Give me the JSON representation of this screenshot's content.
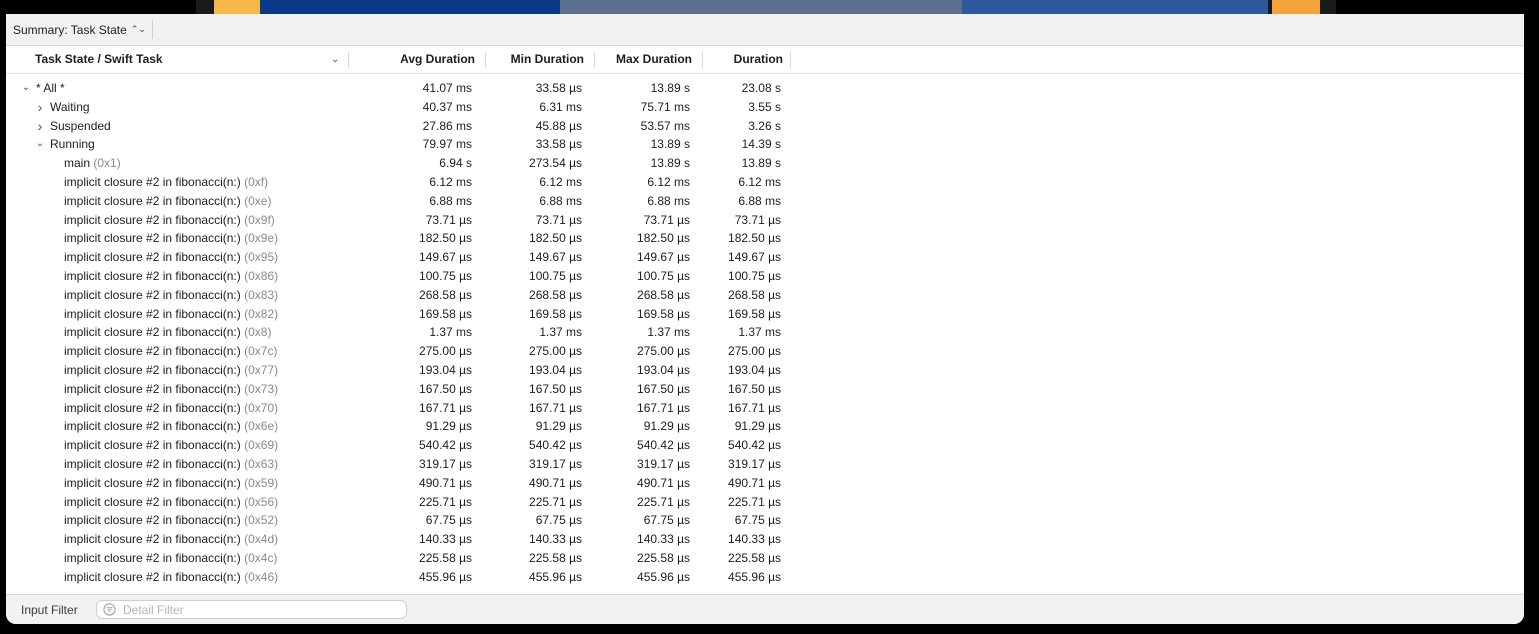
{
  "summary": {
    "label": "Summary: Task State",
    "icon": "up-down-chevron-icon"
  },
  "columns": {
    "task": "Task State / Swift Task",
    "avg": "Avg Duration",
    "min": "Min Duration",
    "max": "Max Duration",
    "dur": "Duration"
  },
  "rows": [
    {
      "level": 0,
      "disc": "open",
      "name": "* All *",
      "addr": "",
      "avg": "41.07 ms",
      "min": "33.58 µs",
      "max": "13.89 s",
      "dur": "23.08 s"
    },
    {
      "level": 1,
      "disc": "closed",
      "name": "Waiting",
      "addr": "",
      "avg": "40.37 ms",
      "min": "6.31 ms",
      "max": "75.71 ms",
      "dur": "3.55 s"
    },
    {
      "level": 1,
      "disc": "closed",
      "name": "Suspended",
      "addr": "",
      "avg": "27.86 ms",
      "min": "45.88 µs",
      "max": "53.57 ms",
      "dur": "3.26 s"
    },
    {
      "level": 1,
      "disc": "open",
      "name": "Running",
      "addr": "",
      "avg": "79.97 ms",
      "min": "33.58 µs",
      "max": "13.89 s",
      "dur": "14.39 s"
    },
    {
      "level": 2,
      "disc": "",
      "name": "main",
      "addr": "(0x1)",
      "avg": "6.94 s",
      "min": "273.54 µs",
      "max": "13.89 s",
      "dur": "13.89 s"
    },
    {
      "level": 2,
      "disc": "",
      "name": "implicit closure #2 in fibonacci(n:)",
      "addr": "(0xf)",
      "avg": "6.12 ms",
      "min": "6.12 ms",
      "max": "6.12 ms",
      "dur": "6.12 ms"
    },
    {
      "level": 2,
      "disc": "",
      "name": "implicit closure #2 in fibonacci(n:)",
      "addr": "(0xe)",
      "avg": "6.88 ms",
      "min": "6.88 ms",
      "max": "6.88 ms",
      "dur": "6.88 ms"
    },
    {
      "level": 2,
      "disc": "",
      "name": "implicit closure #2 in fibonacci(n:)",
      "addr": "(0x9f)",
      "avg": "73.71 µs",
      "min": "73.71 µs",
      "max": "73.71 µs",
      "dur": "73.71 µs"
    },
    {
      "level": 2,
      "disc": "",
      "name": "implicit closure #2 in fibonacci(n:)",
      "addr": "(0x9e)",
      "avg": "182.50 µs",
      "min": "182.50 µs",
      "max": "182.50 µs",
      "dur": "182.50 µs"
    },
    {
      "level": 2,
      "disc": "",
      "name": "implicit closure #2 in fibonacci(n:)",
      "addr": "(0x95)",
      "avg": "149.67 µs",
      "min": "149.67 µs",
      "max": "149.67 µs",
      "dur": "149.67 µs"
    },
    {
      "level": 2,
      "disc": "",
      "name": "implicit closure #2 in fibonacci(n:)",
      "addr": "(0x86)",
      "avg": "100.75 µs",
      "min": "100.75 µs",
      "max": "100.75 µs",
      "dur": "100.75 µs"
    },
    {
      "level": 2,
      "disc": "",
      "name": "implicit closure #2 in fibonacci(n:)",
      "addr": "(0x83)",
      "avg": "268.58 µs",
      "min": "268.58 µs",
      "max": "268.58 µs",
      "dur": "268.58 µs"
    },
    {
      "level": 2,
      "disc": "",
      "name": "implicit closure #2 in fibonacci(n:)",
      "addr": "(0x82)",
      "avg": "169.58 µs",
      "min": "169.58 µs",
      "max": "169.58 µs",
      "dur": "169.58 µs"
    },
    {
      "level": 2,
      "disc": "",
      "name": "implicit closure #2 in fibonacci(n:)",
      "addr": "(0x8)",
      "avg": "1.37 ms",
      "min": "1.37 ms",
      "max": "1.37 ms",
      "dur": "1.37 ms"
    },
    {
      "level": 2,
      "disc": "",
      "name": "implicit closure #2 in fibonacci(n:)",
      "addr": "(0x7c)",
      "avg": "275.00 µs",
      "min": "275.00 µs",
      "max": "275.00 µs",
      "dur": "275.00 µs"
    },
    {
      "level": 2,
      "disc": "",
      "name": "implicit closure #2 in fibonacci(n:)",
      "addr": "(0x77)",
      "avg": "193.04 µs",
      "min": "193.04 µs",
      "max": "193.04 µs",
      "dur": "193.04 µs"
    },
    {
      "level": 2,
      "disc": "",
      "name": "implicit closure #2 in fibonacci(n:)",
      "addr": "(0x73)",
      "avg": "167.50 µs",
      "min": "167.50 µs",
      "max": "167.50 µs",
      "dur": "167.50 µs"
    },
    {
      "level": 2,
      "disc": "",
      "name": "implicit closure #2 in fibonacci(n:)",
      "addr": "(0x70)",
      "avg": "167.71 µs",
      "min": "167.71 µs",
      "max": "167.71 µs",
      "dur": "167.71 µs"
    },
    {
      "level": 2,
      "disc": "",
      "name": "implicit closure #2 in fibonacci(n:)",
      "addr": "(0x6e)",
      "avg": "91.29 µs",
      "min": "91.29 µs",
      "max": "91.29 µs",
      "dur": "91.29 µs"
    },
    {
      "level": 2,
      "disc": "",
      "name": "implicit closure #2 in fibonacci(n:)",
      "addr": "(0x69)",
      "avg": "540.42 µs",
      "min": "540.42 µs",
      "max": "540.42 µs",
      "dur": "540.42 µs"
    },
    {
      "level": 2,
      "disc": "",
      "name": "implicit closure #2 in fibonacci(n:)",
      "addr": "(0x63)",
      "avg": "319.17 µs",
      "min": "319.17 µs",
      "max": "319.17 µs",
      "dur": "319.17 µs"
    },
    {
      "level": 2,
      "disc": "",
      "name": "implicit closure #2 in fibonacci(n:)",
      "addr": "(0x59)",
      "avg": "490.71 µs",
      "min": "490.71 µs",
      "max": "490.71 µs",
      "dur": "490.71 µs"
    },
    {
      "level": 2,
      "disc": "",
      "name": "implicit closure #2 in fibonacci(n:)",
      "addr": "(0x56)",
      "avg": "225.71 µs",
      "min": "225.71 µs",
      "max": "225.71 µs",
      "dur": "225.71 µs"
    },
    {
      "level": 2,
      "disc": "",
      "name": "implicit closure #2 in fibonacci(n:)",
      "addr": "(0x52)",
      "avg": "67.75 µs",
      "min": "67.75 µs",
      "max": "67.75 µs",
      "dur": "67.75 µs"
    },
    {
      "level": 2,
      "disc": "",
      "name": "implicit closure #2 in fibonacci(n:)",
      "addr": "(0x4d)",
      "avg": "140.33 µs",
      "min": "140.33 µs",
      "max": "140.33 µs",
      "dur": "140.33 µs"
    },
    {
      "level": 2,
      "disc": "",
      "name": "implicit closure #2 in fibonacci(n:)",
      "addr": "(0x4c)",
      "avg": "225.58 µs",
      "min": "225.58 µs",
      "max": "225.58 µs",
      "dur": "225.58 µs"
    },
    {
      "level": 2,
      "disc": "",
      "name": "implicit closure #2 in fibonacci(n:)",
      "addr": "(0x46)",
      "avg": "455.96 µs",
      "min": "455.96 µs",
      "max": "455.96 µs",
      "dur": "455.96 µs"
    }
  ],
  "footer": {
    "input_filter": "Input Filter",
    "detail_placeholder": "Detail Filter",
    "detail_value": ""
  }
}
